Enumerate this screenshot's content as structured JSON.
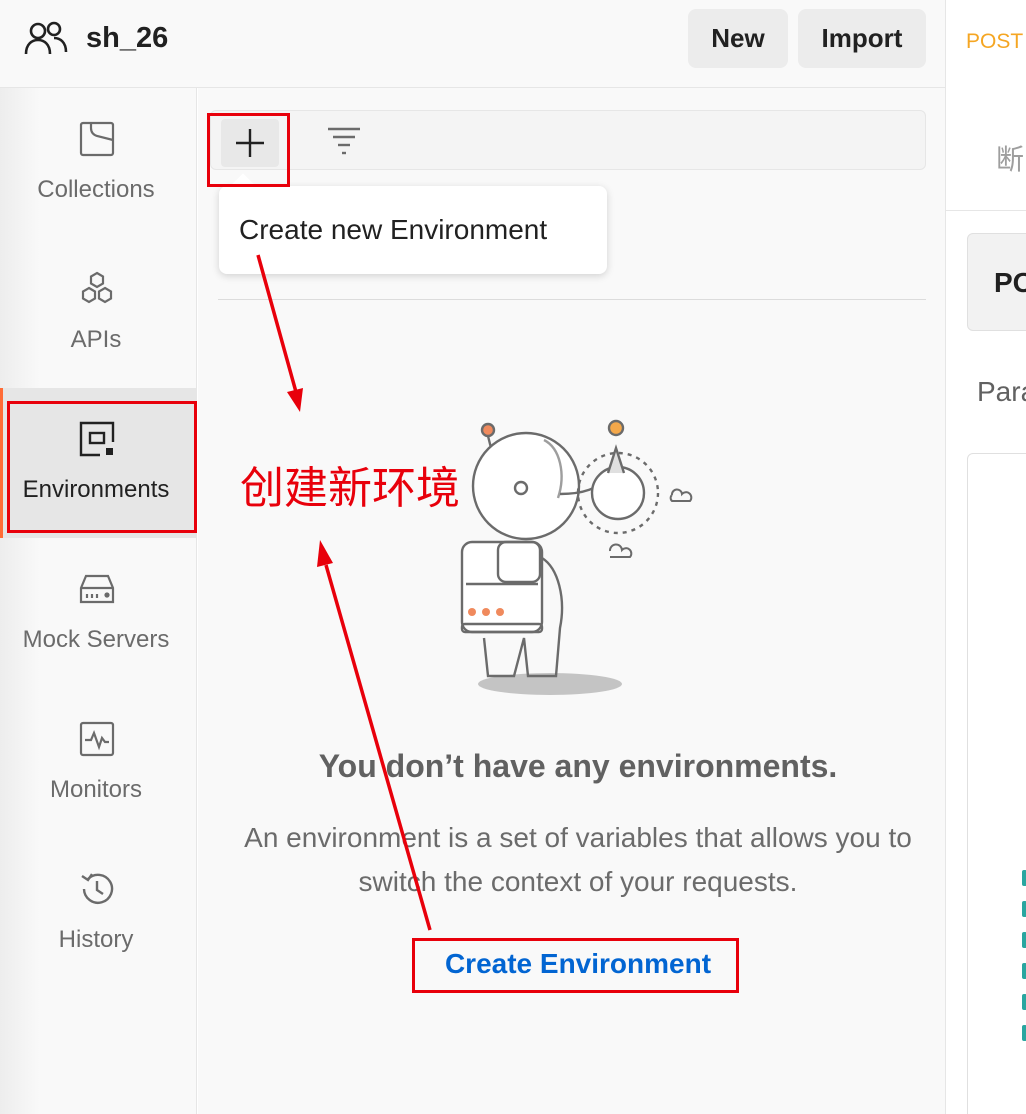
{
  "header": {
    "workspace_name": "sh_26",
    "new_label": "New",
    "import_label": "Import"
  },
  "right_panel": {
    "tab_method": "POST",
    "title_fragment": "断",
    "method": "PO",
    "params_fragment": "Para"
  },
  "sidebar": {
    "items": [
      {
        "label": "Collections",
        "icon": "collections-icon"
      },
      {
        "label": "APIs",
        "icon": "apis-icon"
      },
      {
        "label": "Environments",
        "icon": "environments-icon",
        "active": true
      },
      {
        "label": "Mock Servers",
        "icon": "mock-servers-icon"
      },
      {
        "label": "Monitors",
        "icon": "monitors-icon"
      },
      {
        "label": "History",
        "icon": "history-icon"
      }
    ]
  },
  "environments": {
    "tooltip": "Create new Environment",
    "empty_title": "You don’t have any environments.",
    "empty_description": "An environment is a set of variables that allows you to switch the context of your requests.",
    "create_link": "Create Environment"
  },
  "annotation": {
    "text": "创建新环境",
    "color": "#e8000b"
  },
  "colors": {
    "accent": "#ff6c37",
    "link": "#0265d2",
    "post_method": "#f5a623"
  }
}
